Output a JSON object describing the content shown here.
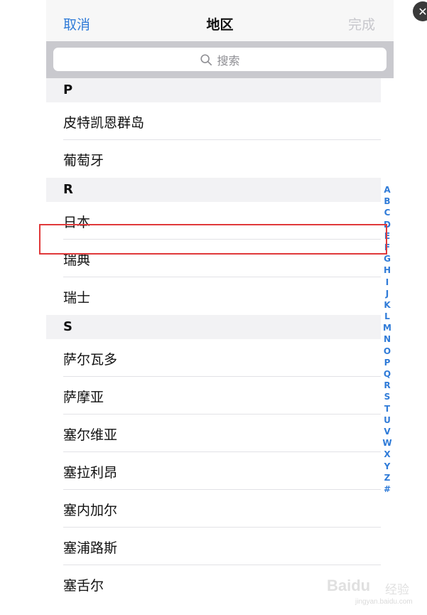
{
  "navbar": {
    "cancel_label": "取消",
    "title": "地区",
    "done_label": "完成"
  },
  "search": {
    "placeholder": "搜索"
  },
  "sections": [
    {
      "letter": "P",
      "items": [
        "皮特凯恩群岛",
        "葡萄牙"
      ]
    },
    {
      "letter": "R",
      "items": [
        "日本",
        "瑞典",
        "瑞士"
      ]
    },
    {
      "letter": "S",
      "items": [
        "萨尔瓦多",
        "萨摩亚",
        "塞尔维亚",
        "塞拉利昂",
        "塞内加尔",
        "塞浦路斯",
        "塞舌尔"
      ]
    }
  ],
  "index_letters": [
    "A",
    "B",
    "C",
    "D",
    "E",
    "F",
    "G",
    "H",
    "I",
    "J",
    "K",
    "L",
    "M",
    "N",
    "O",
    "P",
    "Q",
    "R",
    "S",
    "T",
    "U",
    "V",
    "W",
    "X",
    "Y",
    "Z",
    "#"
  ],
  "highlight": {
    "item": "日本",
    "color": "#e0393a"
  },
  "watermark": {
    "brand": "Baidu",
    "cn": "经验",
    "url": "jingyan.baidu.com"
  },
  "colors": {
    "accent": "#2f7bd8",
    "disabled": "#c7c7cc"
  },
  "close_icon": "close-icon"
}
